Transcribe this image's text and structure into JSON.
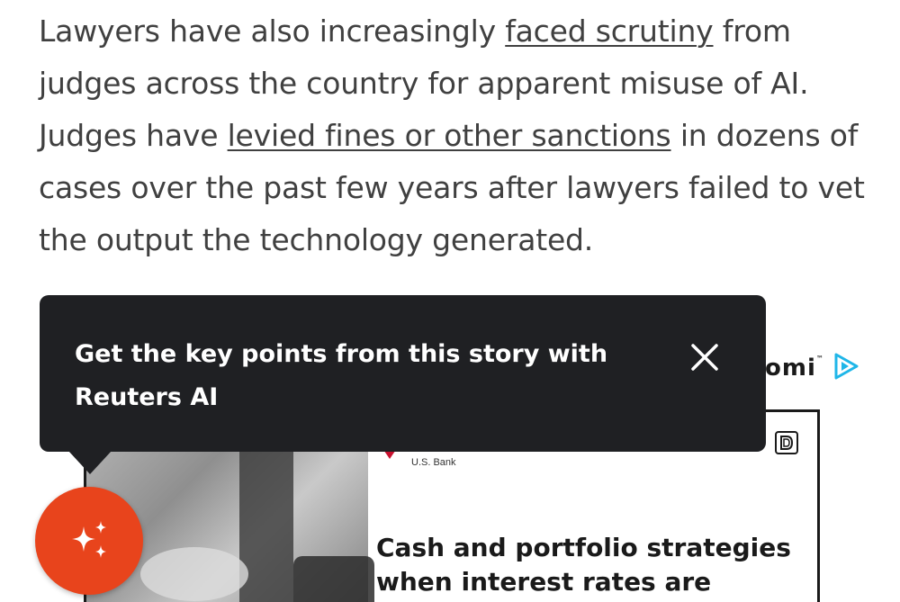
{
  "article": {
    "p1_before": "Lawyers have also increasingly ",
    "link1": "faced scrutiny",
    "p1_middle": " from judges across the country for apparent misuse of AI. Judges have ",
    "link2": "levied fines or other sanctions",
    "p1_after": " in dozens of cases over the past few years after lawyers failed to vet the output the technology generated."
  },
  "tooltip": {
    "text": "Get the key points from this story with Reuters AI",
    "close_icon": "close-icon"
  },
  "ad": {
    "brand_partial": "omi",
    "brand_tm": "™",
    "sponsor": "U.S. Bank",
    "headline": "Cash and portfolio strategies when interest rates are",
    "adchoices_icon": "adchoices-icon",
    "play_icon": "play-triangle-icon"
  },
  "fab": {
    "icon": "sparkles-icon",
    "color": "#e8441c"
  },
  "colors": {
    "body_text": "#404040",
    "tooltip_bg": "#1f2023",
    "fab": "#e8441c"
  }
}
